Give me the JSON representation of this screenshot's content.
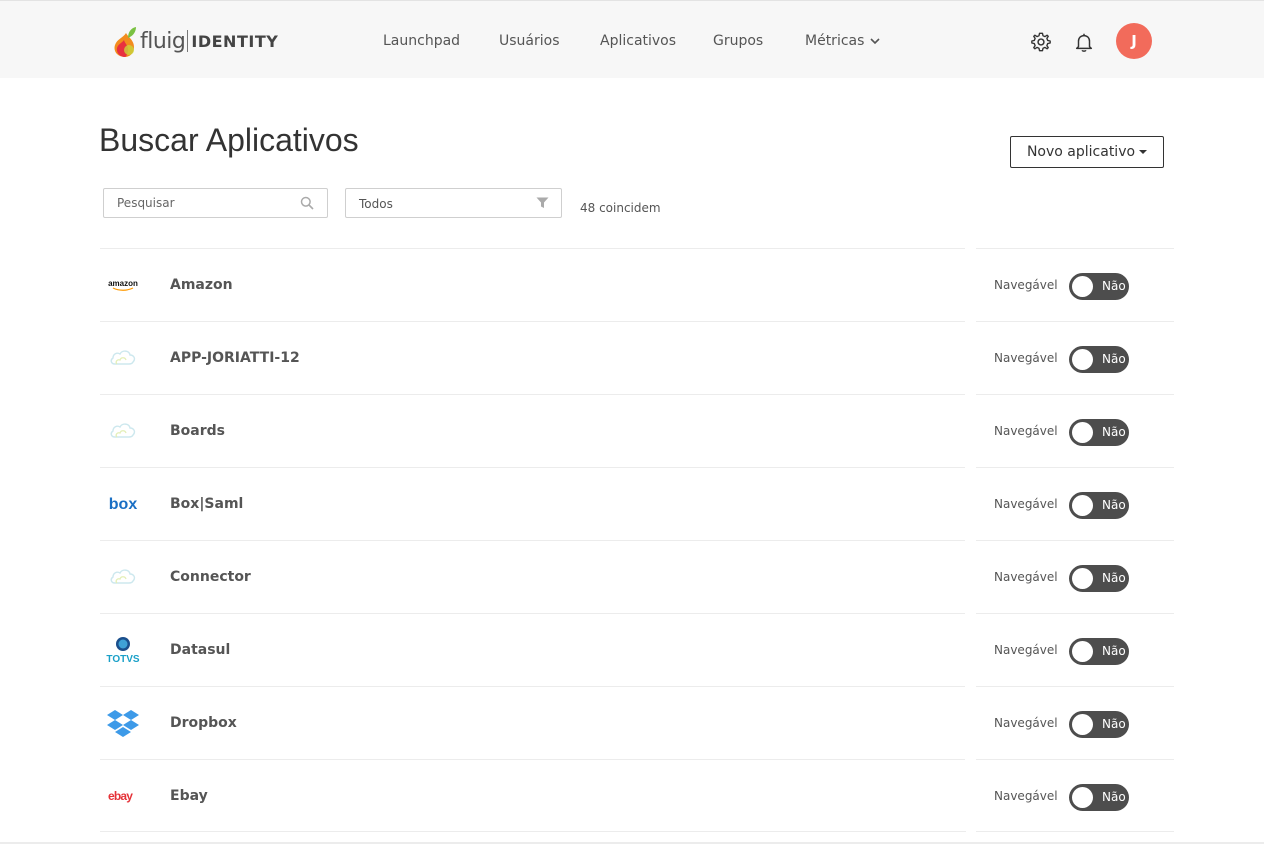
{
  "header": {
    "brand_fluig": "fluig",
    "brand_identity": "IDENTITY",
    "nav": [
      "Launchpad",
      "Usuários",
      "Aplicativos",
      "Grupos",
      "Métricas"
    ],
    "avatar_initial": "J"
  },
  "page": {
    "title": "Buscar Aplicativos",
    "new_app_label": "Novo aplicativo",
    "search_placeholder": "Pesquisar",
    "filter_value": "Todos",
    "match_count": "48 coincidem"
  },
  "apps": [
    {
      "name": "Amazon",
      "logo": "amazon-logo",
      "label": "Navegável",
      "toggle": "Não"
    },
    {
      "name": "APP-JORIATTI-12",
      "logo": "cloud-icon",
      "label": "Navegável",
      "toggle": "Não"
    },
    {
      "name": "Boards",
      "logo": "cloud-icon",
      "label": "Navegável",
      "toggle": "Não"
    },
    {
      "name": "Box|Saml",
      "logo": "box-logo",
      "label": "Navegável",
      "toggle": "Não"
    },
    {
      "name": "Connector",
      "logo": "cloud-icon",
      "label": "Navegável",
      "toggle": "Não"
    },
    {
      "name": "Datasul",
      "logo": "totvs-logo",
      "label": "Navegável",
      "toggle": "Não"
    },
    {
      "name": "Dropbox",
      "logo": "dropbox-logo",
      "label": "Navegável",
      "toggle": "Não"
    },
    {
      "name": "Ebay",
      "logo": "ebay-logo",
      "label": "Navegável",
      "toggle": "Não"
    }
  ],
  "logo_text": {
    "amazon": "amazon",
    "box": "box",
    "totvs": "TOTVS",
    "ebay": "ebay"
  },
  "colors": {
    "topbar_bg": "#f7f7f7",
    "avatar": "#f26b5b",
    "toggle_off": "#4d4d4d"
  }
}
